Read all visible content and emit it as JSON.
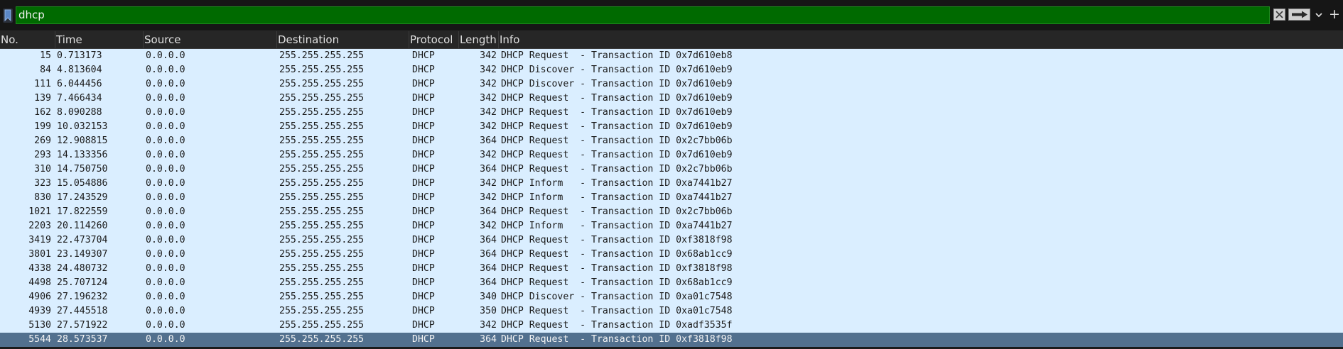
{
  "filter": {
    "value": "dhcp",
    "plus_label": "+"
  },
  "columns": [
    "No.",
    "Time",
    "Source",
    "Destination",
    "Protocol",
    "Length",
    "Info"
  ],
  "rows": [
    {
      "no": "15",
      "time": "0.713173",
      "source": "0.0.0.0",
      "destination": "255.255.255.255",
      "protocol": "DHCP",
      "length": "342",
      "info": "DHCP Request  - Transaction ID 0x7d610eb8"
    },
    {
      "no": "84",
      "time": "4.813604",
      "source": "0.0.0.0",
      "destination": "255.255.255.255",
      "protocol": "DHCP",
      "length": "342",
      "info": "DHCP Discover - Transaction ID 0x7d610eb9"
    },
    {
      "no": "111",
      "time": "6.044456",
      "source": "0.0.0.0",
      "destination": "255.255.255.255",
      "protocol": "DHCP",
      "length": "342",
      "info": "DHCP Discover - Transaction ID 0x7d610eb9"
    },
    {
      "no": "139",
      "time": "7.466434",
      "source": "0.0.0.0",
      "destination": "255.255.255.255",
      "protocol": "DHCP",
      "length": "342",
      "info": "DHCP Request  - Transaction ID 0x7d610eb9"
    },
    {
      "no": "162",
      "time": "8.090288",
      "source": "0.0.0.0",
      "destination": "255.255.255.255",
      "protocol": "DHCP",
      "length": "342",
      "info": "DHCP Request  - Transaction ID 0x7d610eb9"
    },
    {
      "no": "199",
      "time": "10.032153",
      "source": "0.0.0.0",
      "destination": "255.255.255.255",
      "protocol": "DHCP",
      "length": "342",
      "info": "DHCP Request  - Transaction ID 0x7d610eb9"
    },
    {
      "no": "269",
      "time": "12.908815",
      "source": "0.0.0.0",
      "destination": "255.255.255.255",
      "protocol": "DHCP",
      "length": "364",
      "info": "DHCP Request  - Transaction ID 0x2c7bb06b"
    },
    {
      "no": "293",
      "time": "14.133356",
      "source": "0.0.0.0",
      "destination": "255.255.255.255",
      "protocol": "DHCP",
      "length": "342",
      "info": "DHCP Request  - Transaction ID 0x7d610eb9"
    },
    {
      "no": "310",
      "time": "14.750750",
      "source": "0.0.0.0",
      "destination": "255.255.255.255",
      "protocol": "DHCP",
      "length": "364",
      "info": "DHCP Request  - Transaction ID 0x2c7bb06b"
    },
    {
      "no": "323",
      "time": "15.054886",
      "source": "0.0.0.0",
      "destination": "255.255.255.255",
      "protocol": "DHCP",
      "length": "342",
      "info": "DHCP Inform   - Transaction ID 0xa7441b27"
    },
    {
      "no": "830",
      "time": "17.243529",
      "source": "0.0.0.0",
      "destination": "255.255.255.255",
      "protocol": "DHCP",
      "length": "342",
      "info": "DHCP Inform   - Transaction ID 0xa7441b27"
    },
    {
      "no": "1021",
      "time": "17.822559",
      "source": "0.0.0.0",
      "destination": "255.255.255.255",
      "protocol": "DHCP",
      "length": "364",
      "info": "DHCP Request  - Transaction ID 0x2c7bb06b"
    },
    {
      "no": "2203",
      "time": "20.114260",
      "source": "0.0.0.0",
      "destination": "255.255.255.255",
      "protocol": "DHCP",
      "length": "342",
      "info": "DHCP Inform   - Transaction ID 0xa7441b27"
    },
    {
      "no": "3419",
      "time": "22.473704",
      "source": "0.0.0.0",
      "destination": "255.255.255.255",
      "protocol": "DHCP",
      "length": "364",
      "info": "DHCP Request  - Transaction ID 0xf3818f98"
    },
    {
      "no": "3801",
      "time": "23.149307",
      "source": "0.0.0.0",
      "destination": "255.255.255.255",
      "protocol": "DHCP",
      "length": "364",
      "info": "DHCP Request  - Transaction ID 0x68ab1cc9"
    },
    {
      "no": "4338",
      "time": "24.480732",
      "source": "0.0.0.0",
      "destination": "255.255.255.255",
      "protocol": "DHCP",
      "length": "364",
      "info": "DHCP Request  - Transaction ID 0xf3818f98"
    },
    {
      "no": "4498",
      "time": "25.707124",
      "source": "0.0.0.0",
      "destination": "255.255.255.255",
      "protocol": "DHCP",
      "length": "364",
      "info": "DHCP Request  - Transaction ID 0x68ab1cc9"
    },
    {
      "no": "4906",
      "time": "27.196232",
      "source": "0.0.0.0",
      "destination": "255.255.255.255",
      "protocol": "DHCP",
      "length": "340",
      "info": "DHCP Discover - Transaction ID 0xa01c7548"
    },
    {
      "no": "4939",
      "time": "27.445518",
      "source": "0.0.0.0",
      "destination": "255.255.255.255",
      "protocol": "DHCP",
      "length": "350",
      "info": "DHCP Request  - Transaction ID 0xa01c7548"
    },
    {
      "no": "5130",
      "time": "27.571922",
      "source": "0.0.0.0",
      "destination": "255.255.255.255",
      "protocol": "DHCP",
      "length": "342",
      "info": "DHCP Request  - Transaction ID 0xadf3535f"
    },
    {
      "no": "5544",
      "time": "28.573537",
      "source": "0.0.0.0",
      "destination": "255.255.255.255",
      "protocol": "DHCP",
      "length": "364",
      "info": "DHCP Request  - Transaction ID 0xf3818f98",
      "selected": true
    }
  ],
  "colors": {
    "filter_valid": "#006a00",
    "row_bg": "#daeeff",
    "row_selected": "#52708e",
    "header_bg": "#262626"
  }
}
